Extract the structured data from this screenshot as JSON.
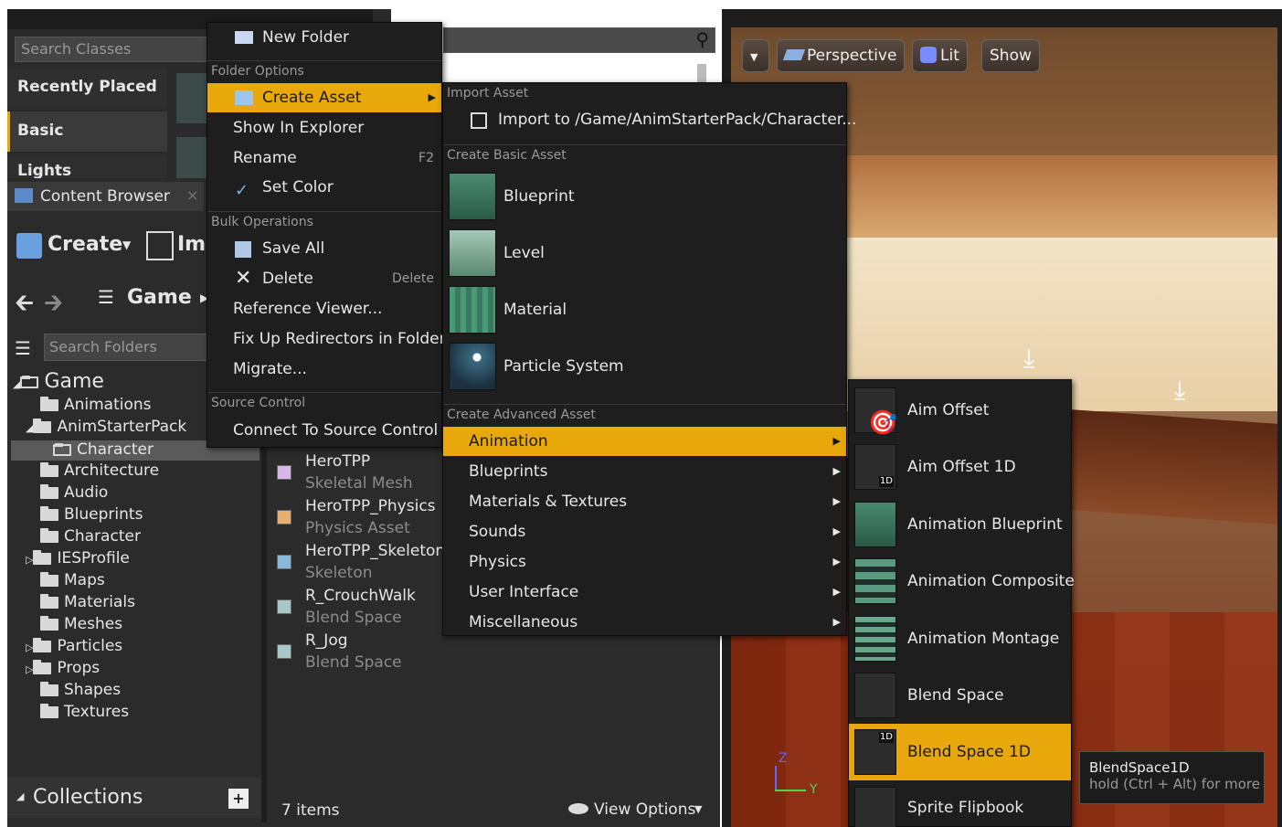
{
  "modes": {
    "search_placeholder": "Search Classes",
    "categories": [
      "Recently Placed",
      "Basic",
      "Lights"
    ]
  },
  "content_browser": {
    "tab_label": "Content Browser",
    "create_label": "Create",
    "import_label": "Imp",
    "path_label": "Game",
    "search_folders_placeholder": "Search Folders",
    "tree": [
      {
        "label": "Game",
        "level": 0
      },
      {
        "label": "Animations",
        "level": 1
      },
      {
        "label": "AnimStarterPack",
        "level": 1
      },
      {
        "label": "Character",
        "level": 2
      },
      {
        "label": "Architecture",
        "level": 1
      },
      {
        "label": "Audio",
        "level": 1
      },
      {
        "label": "Blueprints",
        "level": 1
      },
      {
        "label": "Character",
        "level": 1
      },
      {
        "label": "IESProfile",
        "level": 1
      },
      {
        "label": "Maps",
        "level": 1
      },
      {
        "label": "Materials",
        "level": 1
      },
      {
        "label": "Meshes",
        "level": 1
      },
      {
        "label": "Particles",
        "level": 1
      },
      {
        "label": "Props",
        "level": 1
      },
      {
        "label": "Shapes",
        "level": 1
      },
      {
        "label": "Textures",
        "level": 1
      }
    ],
    "assets": [
      {
        "name": "HeroTPP",
        "type": "Skeletal Mesh"
      },
      {
        "name": "HeroTPP_Physics",
        "type": "Physics Asset"
      },
      {
        "name": "HeroTPP_Skeleton",
        "type": "Skeleton"
      },
      {
        "name": "R_CrouchWalk",
        "type": "Blend Space"
      },
      {
        "name": "R_Jog",
        "type": "Blend Space"
      }
    ],
    "collections_label": "Collections",
    "item_count": "7 items",
    "view_options": "View Options"
  },
  "viewport": {
    "perspective": "Perspective",
    "lit": "Lit",
    "show": "Show",
    "axis_z": "Z",
    "axis_y": "Y"
  },
  "folder_menu": {
    "new_folder": "New Folder",
    "section_folder_options": "Folder Options",
    "create_asset": "Create Asset",
    "show_in_explorer": "Show In Explorer",
    "rename": "Rename",
    "rename_shortcut": "F2",
    "set_color": "Set Color",
    "section_bulk": "Bulk Operations",
    "save_all": "Save All",
    "delete": "Delete",
    "delete_shortcut": "Delete",
    "reference_viewer": "Reference Viewer...",
    "fix_up": "Fix Up Redirectors in Folder",
    "migrate": "Migrate...",
    "section_source": "Source Control",
    "connect_source": "Connect To Source Control"
  },
  "create_menu": {
    "section_import": "Import Asset",
    "import_to": "Import to /Game/AnimStarterPack/Character...",
    "section_basic": "Create Basic Asset",
    "basic": [
      "Blueprint",
      "Level",
      "Material",
      "Particle System"
    ],
    "section_advanced": "Create Advanced Asset",
    "advanced": [
      "Animation",
      "Blueprints",
      "Materials & Textures",
      "Sounds",
      "Physics",
      "User Interface",
      "Miscellaneous"
    ]
  },
  "animation_menu": {
    "items": [
      "Aim Offset",
      "Aim Offset 1D",
      "Animation Blueprint",
      "Animation Composite",
      "Animation Montage",
      "Blend Space",
      "Blend Space 1D",
      "Sprite Flipbook"
    ],
    "badge_1d": "1D"
  },
  "tooltip": {
    "title": "BlendSpace1D",
    "hint": "hold (Ctrl + Alt) for more"
  },
  "colors": {
    "highlight": "#e8a80c",
    "panel": "#242424",
    "menu": "#1e1e1e"
  }
}
